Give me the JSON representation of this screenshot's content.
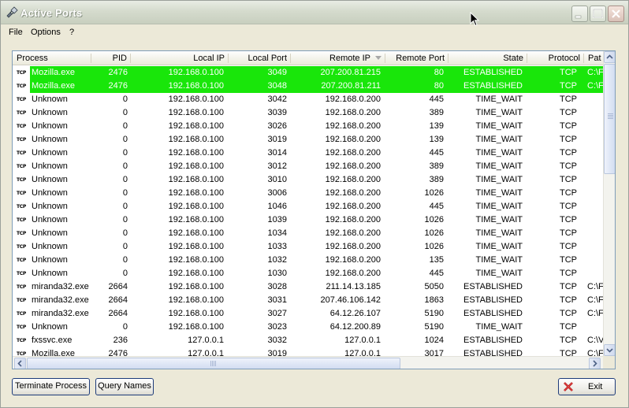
{
  "window": {
    "title": "Active Ports"
  },
  "menu": {
    "file": "File",
    "options": "Options",
    "help": "?"
  },
  "columns": [
    "Process",
    "PID",
    "Local IP",
    "Local Port",
    "Remote IP",
    "Remote Port",
    "State",
    "Protocol",
    "Pat"
  ],
  "protocol_icon_text": "TCP",
  "rows": [
    {
      "process": "Mozilla.exe",
      "pid": "2476",
      "local_ip": "192.168.0.100",
      "local_port": "3049",
      "remote_ip": "207.200.81.215",
      "remote_port": "80",
      "state": "ESTABLISHED",
      "protocol": "TCP",
      "path": "C:\\F",
      "highlight": true
    },
    {
      "process": "Mozilla.exe",
      "pid": "2476",
      "local_ip": "192.168.0.100",
      "local_port": "3048",
      "remote_ip": "207.200.81.211",
      "remote_port": "80",
      "state": "ESTABLISHED",
      "protocol": "TCP",
      "path": "C:\\F",
      "highlight": true
    },
    {
      "process": "Unknown",
      "pid": "0",
      "local_ip": "192.168.0.100",
      "local_port": "3042",
      "remote_ip": "192.168.0.200",
      "remote_port": "445",
      "state": "TIME_WAIT",
      "protocol": "TCP",
      "path": ""
    },
    {
      "process": "Unknown",
      "pid": "0",
      "local_ip": "192.168.0.100",
      "local_port": "3039",
      "remote_ip": "192.168.0.200",
      "remote_port": "389",
      "state": "TIME_WAIT",
      "protocol": "TCP",
      "path": ""
    },
    {
      "process": "Unknown",
      "pid": "0",
      "local_ip": "192.168.0.100",
      "local_port": "3026",
      "remote_ip": "192.168.0.200",
      "remote_port": "139",
      "state": "TIME_WAIT",
      "protocol": "TCP",
      "path": ""
    },
    {
      "process": "Unknown",
      "pid": "0",
      "local_ip": "192.168.0.100",
      "local_port": "3019",
      "remote_ip": "192.168.0.200",
      "remote_port": "139",
      "state": "TIME_WAIT",
      "protocol": "TCP",
      "path": ""
    },
    {
      "process": "Unknown",
      "pid": "0",
      "local_ip": "192.168.0.100",
      "local_port": "3014",
      "remote_ip": "192.168.0.200",
      "remote_port": "445",
      "state": "TIME_WAIT",
      "protocol": "TCP",
      "path": ""
    },
    {
      "process": "Unknown",
      "pid": "0",
      "local_ip": "192.168.0.100",
      "local_port": "3012",
      "remote_ip": "192.168.0.200",
      "remote_port": "389",
      "state": "TIME_WAIT",
      "protocol": "TCP",
      "path": ""
    },
    {
      "process": "Unknown",
      "pid": "0",
      "local_ip": "192.168.0.100",
      "local_port": "3010",
      "remote_ip": "192.168.0.200",
      "remote_port": "389",
      "state": "TIME_WAIT",
      "protocol": "TCP",
      "path": ""
    },
    {
      "process": "Unknown",
      "pid": "0",
      "local_ip": "192.168.0.100",
      "local_port": "3006",
      "remote_ip": "192.168.0.200",
      "remote_port": "1026",
      "state": "TIME_WAIT",
      "protocol": "TCP",
      "path": ""
    },
    {
      "process": "Unknown",
      "pid": "0",
      "local_ip": "192.168.0.100",
      "local_port": "1046",
      "remote_ip": "192.168.0.200",
      "remote_port": "445",
      "state": "TIME_WAIT",
      "protocol": "TCP",
      "path": ""
    },
    {
      "process": "Unknown",
      "pid": "0",
      "local_ip": "192.168.0.100",
      "local_port": "1039",
      "remote_ip": "192.168.0.200",
      "remote_port": "1026",
      "state": "TIME_WAIT",
      "protocol": "TCP",
      "path": ""
    },
    {
      "process": "Unknown",
      "pid": "0",
      "local_ip": "192.168.0.100",
      "local_port": "1034",
      "remote_ip": "192.168.0.200",
      "remote_port": "1026",
      "state": "TIME_WAIT",
      "protocol": "TCP",
      "path": ""
    },
    {
      "process": "Unknown",
      "pid": "0",
      "local_ip": "192.168.0.100",
      "local_port": "1033",
      "remote_ip": "192.168.0.200",
      "remote_port": "1026",
      "state": "TIME_WAIT",
      "protocol": "TCP",
      "path": ""
    },
    {
      "process": "Unknown",
      "pid": "0",
      "local_ip": "192.168.0.100",
      "local_port": "1032",
      "remote_ip": "192.168.0.200",
      "remote_port": "135",
      "state": "TIME_WAIT",
      "protocol": "TCP",
      "path": ""
    },
    {
      "process": "Unknown",
      "pid": "0",
      "local_ip": "192.168.0.100",
      "local_port": "1030",
      "remote_ip": "192.168.0.200",
      "remote_port": "445",
      "state": "TIME_WAIT",
      "protocol": "TCP",
      "path": ""
    },
    {
      "process": "miranda32.exe",
      "pid": "2664",
      "local_ip": "192.168.0.100",
      "local_port": "3028",
      "remote_ip": "211.14.13.185",
      "remote_port": "5050",
      "state": "ESTABLISHED",
      "protocol": "TCP",
      "path": "C:\\F"
    },
    {
      "process": "miranda32.exe",
      "pid": "2664",
      "local_ip": "192.168.0.100",
      "local_port": "3031",
      "remote_ip": "207.46.106.142",
      "remote_port": "1863",
      "state": "ESTABLISHED",
      "protocol": "TCP",
      "path": "C:\\F"
    },
    {
      "process": "miranda32.exe",
      "pid": "2664",
      "local_ip": "192.168.0.100",
      "local_port": "3027",
      "remote_ip": "64.12.26.107",
      "remote_port": "5190",
      "state": "ESTABLISHED",
      "protocol": "TCP",
      "path": "C:\\F"
    },
    {
      "process": "Unknown",
      "pid": "0",
      "local_ip": "192.168.0.100",
      "local_port": "3023",
      "remote_ip": "64.12.200.89",
      "remote_port": "5190",
      "state": "TIME_WAIT",
      "protocol": "TCP",
      "path": ""
    },
    {
      "process": "fxssvc.exe",
      "pid": "236",
      "local_ip": "127.0.0.1",
      "local_port": "3032",
      "remote_ip": "127.0.0.1",
      "remote_port": "1024",
      "state": "ESTABLISHED",
      "protocol": "TCP",
      "path": "C:\\V"
    },
    {
      "process": "Mozilla.exe",
      "pid": "2476",
      "local_ip": "127.0.0.1",
      "local_port": "3019",
      "remote_ip": "127.0.0.1",
      "remote_port": "3017",
      "state": "ESTABLISHED",
      "protocol": "TCP",
      "path": "C:\\F"
    }
  ],
  "buttons": {
    "terminate": "Terminate Process",
    "query": "Query Names",
    "exit": "Exit"
  },
  "colors": {
    "highlight_row": "#19e60a",
    "window_bg": "#ece9d8",
    "list_border": "#7f9db9"
  }
}
